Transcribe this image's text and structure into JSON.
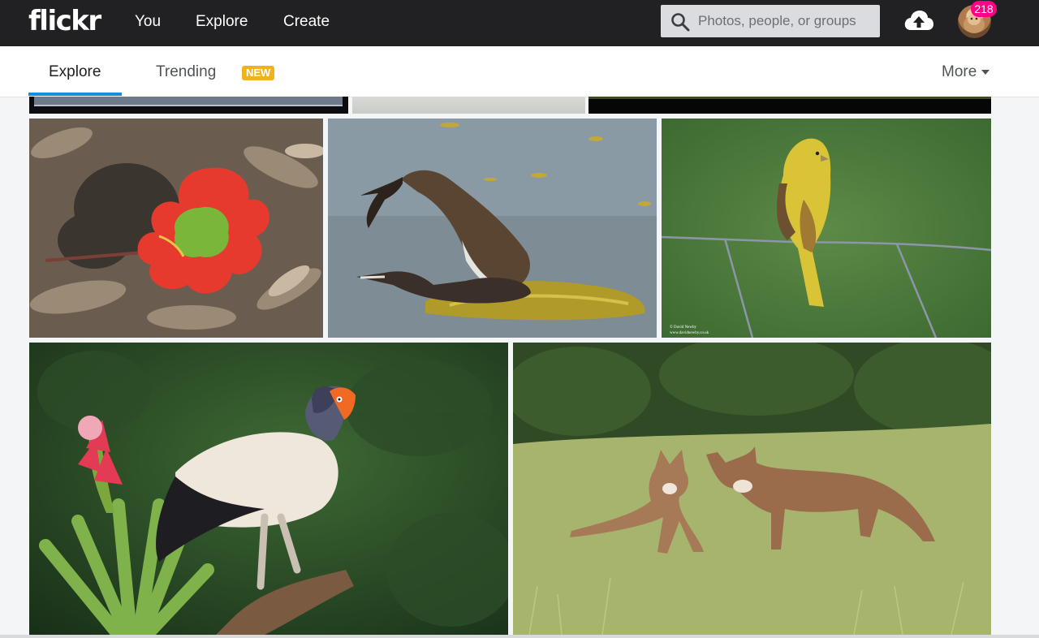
{
  "header": {
    "logo": "flickr",
    "nav": [
      {
        "label": "You"
      },
      {
        "label": "Explore"
      },
      {
        "label": "Create"
      }
    ],
    "search": {
      "placeholder": "Photos, people, or groups",
      "value": ""
    },
    "notification_count": "218",
    "icons": [
      "search-icon",
      "upload-cloud-icon",
      "avatar"
    ]
  },
  "subnav": {
    "tabs": [
      {
        "label": "Explore",
        "active": true
      },
      {
        "label": "Trending",
        "active": false
      }
    ],
    "new_badge": "NEW",
    "more_label": "More"
  },
  "colors": {
    "topbar": "#212124",
    "active_tab_underline": "#128fdc",
    "new_badge": "#f0b31b",
    "notification_badge": "#ff0084"
  },
  "photos": [
    {
      "subject": "red-leaf-on-dry-leaves"
    },
    {
      "subject": "grebes-on-nest"
    },
    {
      "subject": "yellowhammer-on-wire-fence"
    },
    {
      "subject": "king-vulture-with-bromeliad"
    },
    {
      "subject": "two-foxes-in-grass"
    }
  ],
  "photo_watermarks": [
    "© David Newby",
    "www.davidnewby.co.uk"
  ]
}
